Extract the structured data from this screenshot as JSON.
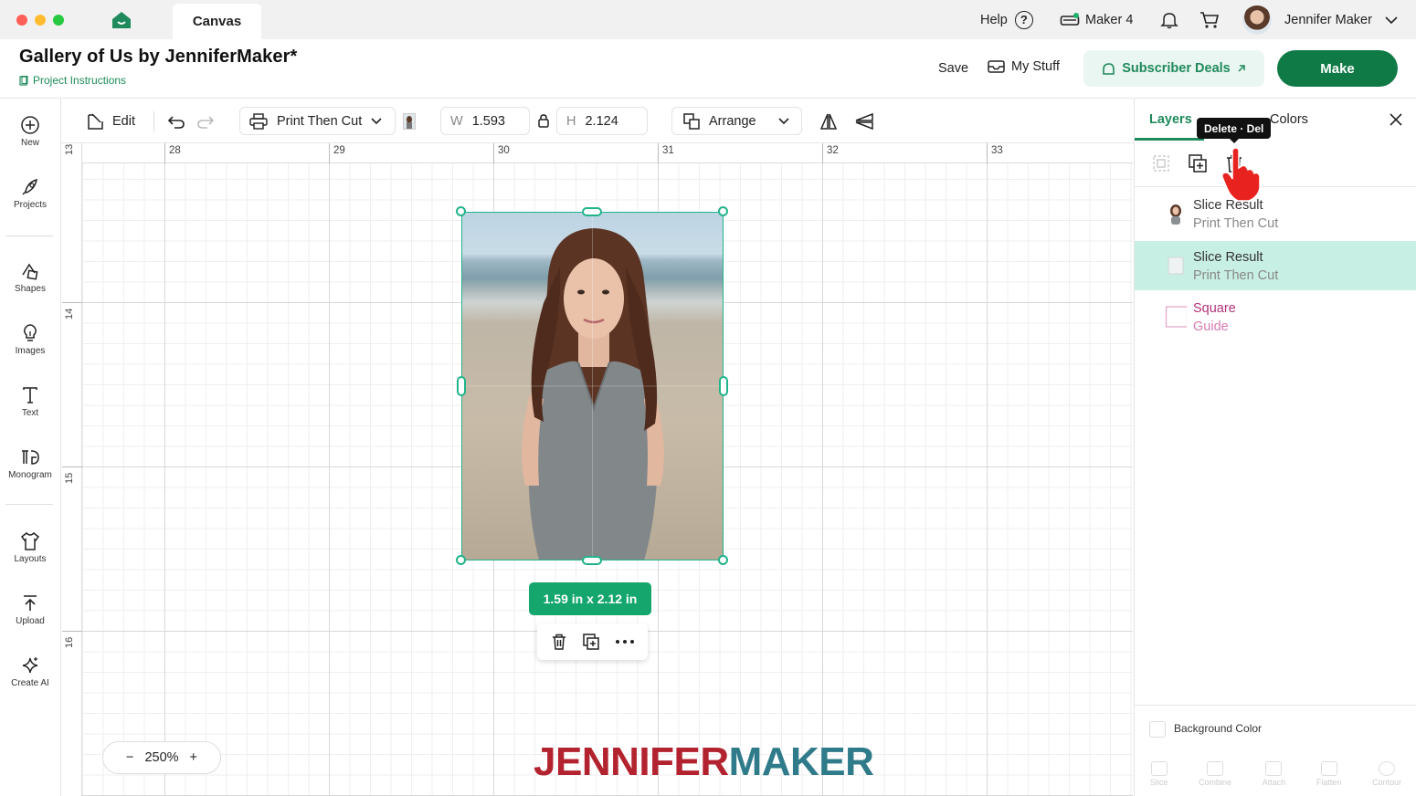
{
  "window": {
    "tab_label": "Canvas",
    "help_label": "Help",
    "help_glyph": "?",
    "machine_label": "Maker 4",
    "user_name": "Jennifer Maker"
  },
  "header": {
    "project_title": "Gallery of Us by JenniferMaker*",
    "project_instructions": "Project Instructions",
    "save_label": "Save",
    "mystuff_label": "My Stuff",
    "deals_label": "Subscriber Deals",
    "make_label": "Make",
    "accent_color": "#107a47"
  },
  "sidebar": {
    "items": [
      {
        "label": "New",
        "icon": "plus-circle-icon"
      },
      {
        "label": "Projects",
        "icon": "rocket-icon"
      },
      {
        "label": "Shapes",
        "icon": "shapes-icon"
      },
      {
        "label": "Images",
        "icon": "lightbulb-icon"
      },
      {
        "label": "Text",
        "icon": "text-icon"
      },
      {
        "label": "Monogram",
        "icon": "monogram-icon"
      },
      {
        "label": "Layouts",
        "icon": "shirt-icon"
      },
      {
        "label": "Upload",
        "icon": "upload-icon"
      },
      {
        "label": "Create AI",
        "icon": "sparkle-icon"
      }
    ]
  },
  "toolbar": {
    "edit_label": "Edit",
    "operation_label": "Print Then Cut",
    "width_label": "W",
    "width_value": "1.593",
    "height_label": "H",
    "height_value": "2.124",
    "arrange_label": "Arrange"
  },
  "canvas": {
    "ruler_top": [
      "28",
      "29",
      "30",
      "31",
      "32",
      "33"
    ],
    "ruler_left": [
      "13",
      "14",
      "15",
      "16"
    ],
    "size_badge": "1.59  in x 2.12  in",
    "zoom_minus": "−",
    "zoom_level": "250%",
    "zoom_plus": "+",
    "watermark_part1": "JENNIFER",
    "watermark_part2": "MAKER"
  },
  "layers_panel": {
    "tab_layers": "Layers",
    "tab_colors": "Colors",
    "tooltip": "Delete · Del",
    "layers": [
      {
        "name": "Slice Result",
        "type": "Print Then Cut",
        "selected": false
      },
      {
        "name": "Slice Result",
        "type": "Print Then Cut",
        "selected": true
      },
      {
        "name": "Square",
        "type": "Guide",
        "selected": false
      }
    ],
    "background_color_label": "Background Color",
    "bottom_tools": [
      "Slice",
      "Combine",
      "Attach",
      "Flatten",
      "Contour"
    ]
  }
}
